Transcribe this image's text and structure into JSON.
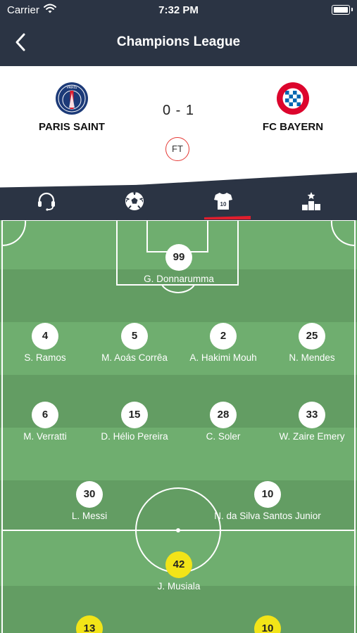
{
  "status_bar": {
    "carrier": "Carrier",
    "time": "7:32 PM"
  },
  "header": {
    "title": "Champions League"
  },
  "match": {
    "home": {
      "name": "PARIS SAINT"
    },
    "away": {
      "name": "FC BAYERN"
    },
    "score": "0 - 1",
    "status": "FT"
  },
  "tabs": [
    {
      "icon": "headset-icon"
    },
    {
      "icon": "soccer-ball-icon"
    },
    {
      "icon": "jersey-icon",
      "active": true
    },
    {
      "icon": "podium-icon"
    }
  ],
  "colors": {
    "nav": "#2b3444",
    "pitch_light": "#6fae6f",
    "pitch_dark": "#639d63",
    "accent": "#e01e2d",
    "away_marker": "#f2e418"
  },
  "lineup": {
    "home": [
      {
        "number": "99",
        "name": "G. Donnarumma"
      },
      {
        "number": "4",
        "name": "S. Ramos"
      },
      {
        "number": "5",
        "name": "M. Aoás Corrêa"
      },
      {
        "number": "2",
        "name": "A. Hakimi Mouh"
      },
      {
        "number": "25",
        "name": "N. Mendes"
      },
      {
        "number": "6",
        "name": "M. Verratti"
      },
      {
        "number": "15",
        "name": "D. Hélio Pereira"
      },
      {
        "number": "28",
        "name": "C. Soler"
      },
      {
        "number": "33",
        "name": "W. Zaire Emery"
      },
      {
        "number": "30",
        "name": "L. Messi"
      },
      {
        "number": "10",
        "name": "N. da Silva Santos Junior"
      }
    ],
    "away": [
      {
        "number": "42",
        "name": "J. Musiala"
      },
      {
        "number": "13",
        "name": ""
      },
      {
        "number": "10",
        "name": ""
      }
    ]
  }
}
